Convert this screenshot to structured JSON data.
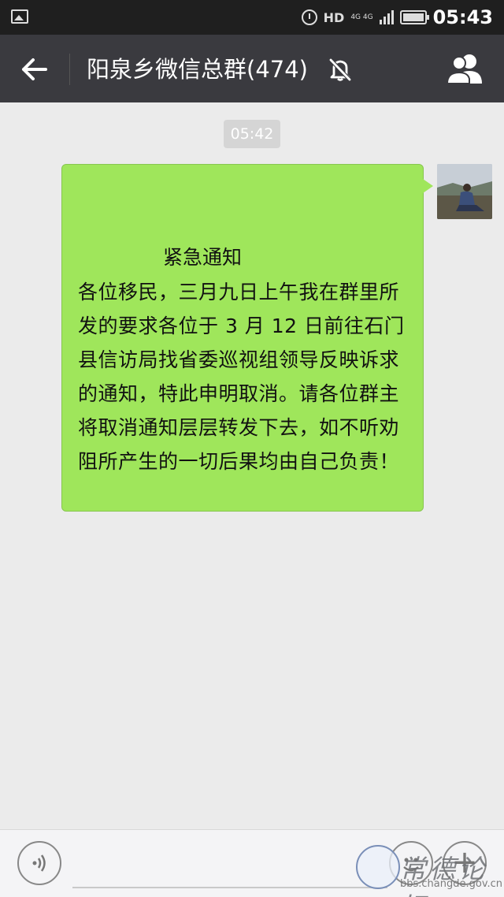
{
  "status_bar": {
    "network_label": "HD",
    "net_type": "4G 4G",
    "time": "05:43"
  },
  "header": {
    "title": "阳泉乡微信总群(474)"
  },
  "chat": {
    "timestamp": "05:42",
    "message": {
      "heading": "紧急通知",
      "body": "各位移民，三月九日上午我在群里所发的要求各位于 3 月 12 日前往石门县信访局找省委巡视组领导反映诉求的通知，特此申明取消。请各位群主将取消通知层层转发下去，如不听劝阻所产生的一切后果均由自己负责！"
    }
  },
  "watermark": {
    "site_name": "常德论坛",
    "url": "bbs.changde.gov.cn"
  },
  "icons": {
    "gallery": "gallery-icon",
    "alarm": "alarm-icon",
    "signal": "signal-icon",
    "battery": "battery-icon",
    "back": "back-arrow-icon",
    "mute": "mute-bell-icon",
    "group": "group-members-icon",
    "voice": "voice-input-icon",
    "emoji": "emoji-icon",
    "plus": "plus-icon"
  },
  "colors": {
    "bubble": "#9fe65b",
    "header": "#3a3a3f",
    "background": "#ebebeb"
  }
}
